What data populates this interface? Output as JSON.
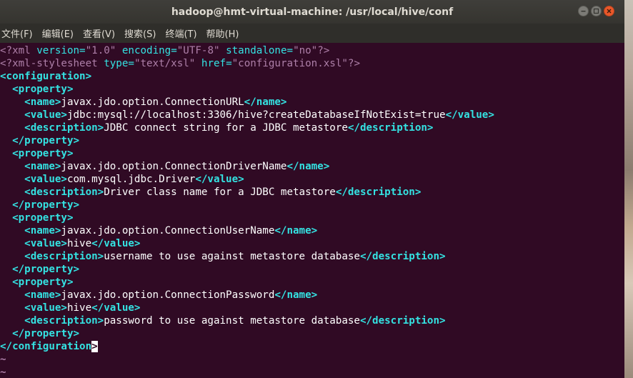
{
  "window": {
    "title": "hadoop@hmt-virtual-machine: /usr/local/hive/conf"
  },
  "menu": [
    "文件(F)",
    "编辑(E)",
    "查看(V)",
    "搜索(S)",
    "终端(T)",
    "帮助(H)"
  ],
  "xml": {
    "decl": {
      "open": "<?xml",
      "version_attr": "version=",
      "version_val": "\"1.0\"",
      "encoding_attr": "encoding=",
      "encoding_val": "\"UTF-8\"",
      "standalone_attr": "standalone=",
      "standalone_val": "\"no\"",
      "close": "?>"
    },
    "stylesheet": {
      "open": "<?xml-stylesheet",
      "type_attr": "type=",
      "type_val": "\"text/xsl\"",
      "href_attr": "href=",
      "href_val": "\"configuration.xsl\"",
      "close": "?>"
    },
    "configuration_open": "<configuration>",
    "configuration_close": "</configuration",
    "cursor_char": ">",
    "property_open": "<property>",
    "property_close": "</property>",
    "name_open": "<name>",
    "name_close": "</name>",
    "value_open": "<value>",
    "value_close": "</value>",
    "desc_open": "<description>",
    "desc_close": "</description>",
    "properties": [
      {
        "name": "javax.jdo.option.ConnectionURL",
        "value": "jdbc:mysql://localhost:3306/hive?createDatabaseIfNotExist=true",
        "description": "JDBC connect string for a JDBC metastore"
      },
      {
        "name": "javax.jdo.option.ConnectionDriverName",
        "value": "com.mysql.jdbc.Driver",
        "description": "Driver class name for a JDBC metastore"
      },
      {
        "name": "javax.jdo.option.ConnectionUserName",
        "value": "hive",
        "description": "username to use against metastore database"
      },
      {
        "name": "javax.jdo.option.ConnectionPassword",
        "value": "hive",
        "description": "password to use against metastore database"
      }
    ],
    "tilde": "~"
  }
}
